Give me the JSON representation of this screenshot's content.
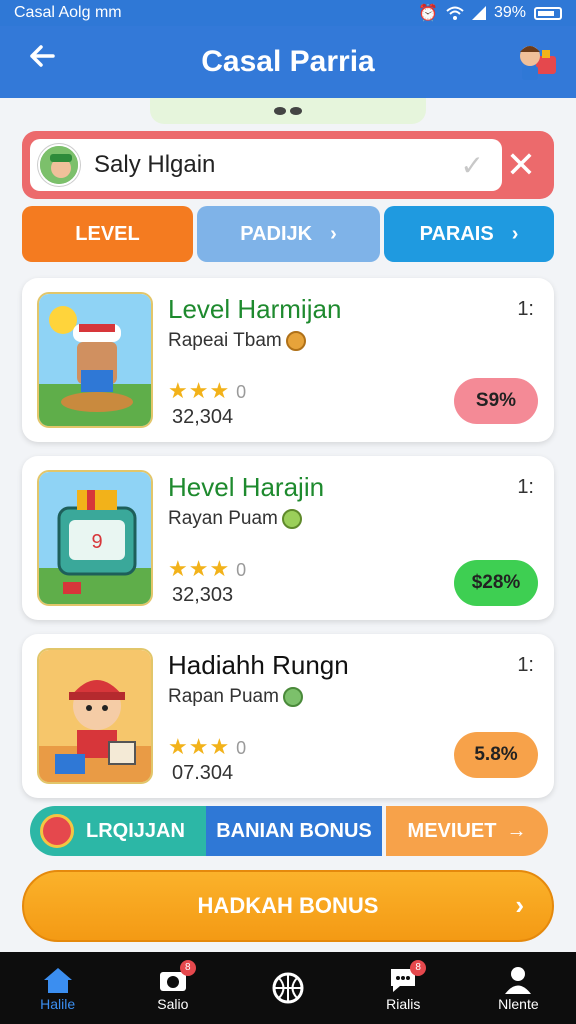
{
  "status_bar": {
    "left_text": "Casal Aolg mm",
    "battery": "39%"
  },
  "app_bar": {
    "title": "Casal Parria"
  },
  "search": {
    "value": "Saly Hlgain"
  },
  "filters": [
    {
      "label": "LEVEL"
    },
    {
      "label": "PADIJK"
    },
    {
      "label": "PARAIS"
    }
  ],
  "cards": [
    {
      "title": "Level Harmijan",
      "subtitle": "Rapeai Tbam",
      "rating_zero": "0",
      "count": "32,304",
      "num": "1:",
      "pill": "S9%",
      "pill_color": "#f48a96",
      "title_color": "#1e8a2e"
    },
    {
      "title": "Hevel Harajin",
      "subtitle": "Rayan Puam",
      "rating_zero": "0",
      "count": "32,303",
      "num": "1:",
      "pill": "$28%",
      "pill_color": "#3ecf52",
      "title_color": "#1e8a2e"
    },
    {
      "title": "Hadiahh Rungn",
      "subtitle": "Rapan Puam",
      "rating_zero": "0",
      "count": "07.304",
      "num": "1:",
      "pill": "5.8%",
      "pill_color": "#f7a24a",
      "title_color": "#111111"
    }
  ],
  "bonus_row": {
    "b1": "LRQIJJAN",
    "b2": "BANIAN BONUS",
    "b3": "MEVIUET"
  },
  "big_button": {
    "label": "HADKAH BONUS"
  },
  "bottom_nav": [
    {
      "label": "Halile",
      "icon": "home-icon"
    },
    {
      "label": "Salio",
      "icon": "camera-icon",
      "badge": "8"
    },
    {
      "label": "",
      "icon": "basketball-icon"
    },
    {
      "label": "Rialis",
      "icon": "chat-icon",
      "badge": "8"
    },
    {
      "label": "Nlente",
      "icon": "person-icon"
    }
  ]
}
